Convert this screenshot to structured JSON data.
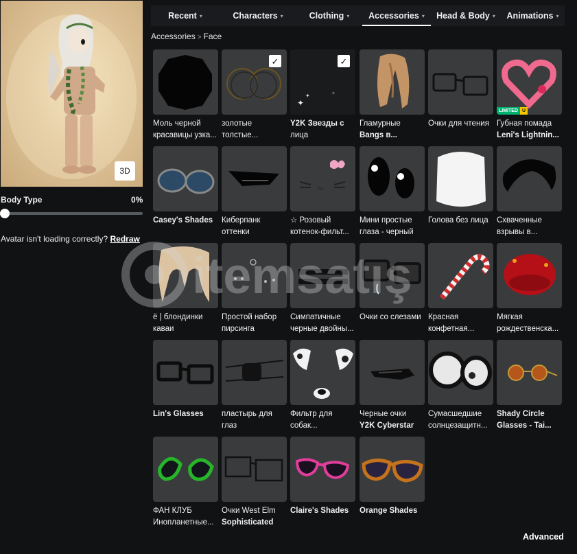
{
  "avatar": {
    "view_3d_label": "3D",
    "body_type_label": "Body Type",
    "body_type_value": "0%",
    "body_type_fraction": 0.0,
    "help_text": "Avatar isn't loading correctly?",
    "redraw_label": "Redraw"
  },
  "tabs": [
    {
      "label": "Recent",
      "chevron": "▾"
    },
    {
      "label": "Characters",
      "chevron": "▾"
    },
    {
      "label": "Clothing",
      "chevron": "▾"
    },
    {
      "label": "Accessories",
      "chevron": "▾"
    },
    {
      "label": "Head & Body",
      "chevron": "▾"
    },
    {
      "label": "Animations",
      "chevron": "▾"
    }
  ],
  "active_tab": "Accessories",
  "breadcrumb": {
    "parent": "Accessories",
    "separator": ">",
    "current": "Face"
  },
  "items": [
    {
      "line1": "Моль черной",
      "line2": "красавицы узка...",
      "icon": "black-moth-icon",
      "selected": false
    },
    {
      "line1": "золотые",
      "line2": "толстые...",
      "icon": "gold-hoops-icon",
      "selected": true
    },
    {
      "line1": "Y2K Звезды с",
      "line2": "лица",
      "icon": "face-stars-icon",
      "selected": true
    },
    {
      "line1": "Гламурные",
      "line2": "Bangs в...",
      "icon": "bangs-icon",
      "selected": false
    },
    {
      "line1": "Очки для чтения",
      "line2": "",
      "icon": "reading-glasses-icon",
      "selected": false
    },
    {
      "line1": "Губная помада",
      "line2": "Leni's Lightnin...",
      "icon": "heart-lips-icon",
      "selected": false,
      "limited": "LIMITED",
      "limited_u": "U"
    },
    {
      "line1": "Casey's Shades",
      "line2": "",
      "icon": "aviator-shades-icon",
      "selected": false
    },
    {
      "line1": "Киберпанк",
      "line2": "оттенки",
      "icon": "cyber-visor-icon",
      "selected": false
    },
    {
      "line1": "☆ Розовый",
      "line2": "котенок-фильт...",
      "icon": "kitty-face-icon",
      "selected": false
    },
    {
      "line1": "Мини простые",
      "line2": "глаза - черный",
      "icon": "black-eyes-icon",
      "selected": false
    },
    {
      "line1": "Голова без лица",
      "line2": "",
      "icon": "faceless-head-icon",
      "selected": false
    },
    {
      "line1": "Схваченные",
      "line2": "взрывы в...",
      "icon": "black-bangs-icon",
      "selected": false
    },
    {
      "line1": "ё | блондинки",
      "line2": "каваи",
      "icon": "blonde-bangs-icon",
      "selected": false
    },
    {
      "line1": "Простой набор",
      "line2": "пирсинга",
      "icon": "piercing-icon",
      "selected": false
    },
    {
      "line1": "Симпатичные",
      "line2": "черные двойны...",
      "icon": "black-bars-icon",
      "selected": false
    },
    {
      "line1": "Очки со слезами",
      "line2": "",
      "icon": "tear-glasses-icon",
      "selected": false
    },
    {
      "line1": "Красная",
      "line2": "конфетная...",
      "icon": "candy-cane-icon",
      "selected": false
    },
    {
      "line1": "Мягкая",
      "line2": "рождественска...",
      "icon": "red-beret-icon",
      "selected": false
    },
    {
      "line1": "Lin's Glasses",
      "line2": "",
      "icon": "square-glasses-icon",
      "selected": false
    },
    {
      "line1": "пластырь для",
      "line2": "глаз",
      "icon": "eyepatch-icon",
      "selected": false
    },
    {
      "line1": "Фильтр для",
      "line2": "собак...",
      "icon": "dog-filter-icon",
      "selected": false
    },
    {
      "line1": "Черные очки",
      "line2": "Y2K Cyberstar",
      "icon": "cyberstar-glasses-icon",
      "selected": false
    },
    {
      "line1": "Сумасшедшие",
      "line2": "солнцезащитн...",
      "icon": "crazy-glasses-icon",
      "selected": false
    },
    {
      "line1": "Shady Circle",
      "line2": "Glasses - Tai...",
      "icon": "round-orange-glasses-icon",
      "selected": false
    },
    {
      "line1": "ФАН КЛУБ",
      "line2": "Инопланетные...",
      "icon": "green-alien-glasses-icon",
      "selected": false
    },
    {
      "line1": "Очки West Elm",
      "line2": "Sophisticated",
      "icon": "wire-glasses-icon",
      "selected": false
    },
    {
      "line1": "Claire's Shades",
      "line2": "",
      "icon": "pink-shades-icon",
      "selected": false
    },
    {
      "line1": "Orange Shades",
      "line2": "",
      "icon": "orange-shades-icon",
      "selected": false
    }
  ],
  "advanced_label": "Advanced",
  "colors": {
    "background": "#111214",
    "tile": "#393b3d",
    "tabbar": "#191b1e",
    "limited_green": "#00b06f",
    "limited_yellow": "#f7c600"
  }
}
